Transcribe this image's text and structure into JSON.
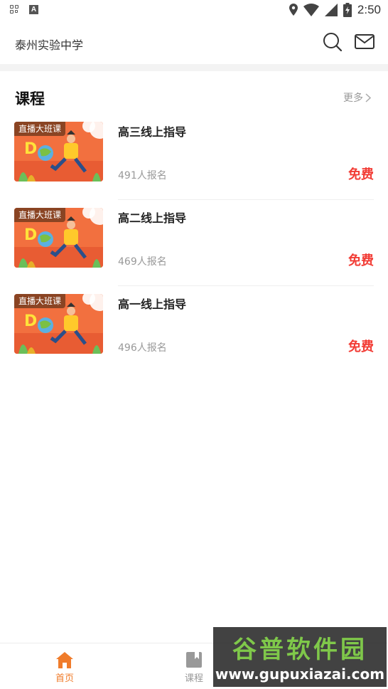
{
  "status_bar": {
    "time": "2:50",
    "left_icons": [
      "grid-icon",
      "font-a-icon"
    ],
    "a_glyph": "A",
    "right_icons": [
      "location-icon",
      "wifi-icon",
      "signal-icon",
      "battery-icon"
    ]
  },
  "header": {
    "title": "泰州实验中学",
    "actions": [
      "search-icon",
      "mail-icon"
    ]
  },
  "section": {
    "title": "课程",
    "more": "更多"
  },
  "courses": [
    {
      "badge": "直播大班课",
      "title": "高三线上指导",
      "enrolled": "491人报名",
      "price": "免费"
    },
    {
      "badge": "直播大班课",
      "title": "高二线上指导",
      "enrolled": "469人报名",
      "price": "免费"
    },
    {
      "badge": "直播大班课",
      "title": "高一线上指导",
      "enrolled": "496人报名",
      "price": "免费"
    }
  ],
  "bottom_nav": [
    {
      "label": "首页",
      "icon": "home-icon",
      "active": true
    },
    {
      "label": "课程",
      "icon": "book-icon",
      "active": false
    }
  ],
  "watermark": {
    "title": "谷普软件园",
    "url": "www.gupuxiazai.com"
  },
  "colors": {
    "accent": "#f07c2b",
    "price": "#f23c35",
    "watermark_green": "#7fc84a"
  }
}
